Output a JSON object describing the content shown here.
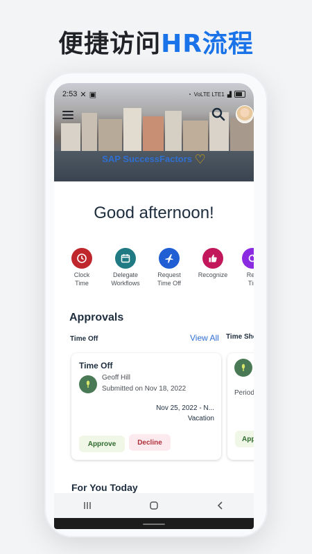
{
  "promo": {
    "title_cn": "便捷访问",
    "title_accent": "HR流程"
  },
  "status": {
    "time": "2:53",
    "network": "VoLTE LTE1"
  },
  "header": {
    "brand": "SAP SuccessFactors"
  },
  "greeting": "Good afternoon!",
  "quick_actions": [
    {
      "label1": "Clock",
      "label2": "Time",
      "color": "#c0272d"
    },
    {
      "label1": "Delegate",
      "label2": "Workflows",
      "color": "#1f7a83"
    },
    {
      "label1": "Request",
      "label2": "Time Off",
      "color": "#1f5fd3"
    },
    {
      "label1": "Recognize",
      "label2": "",
      "color": "#c2185b"
    },
    {
      "label1": "Req",
      "label2": "Tin",
      "color": "#8a2be2"
    }
  ],
  "approvals": {
    "title": "Approvals",
    "tab_time_off": "Time Off",
    "view_all": "View All",
    "tab_time_sheet": "Time She",
    "card1": {
      "title": "Time Off",
      "name": "Geoff Hill",
      "submitted": "Submitted on Nov 18, 2022",
      "dates": "Nov 25, 2022 - N...",
      "type": "Vacation",
      "approve": "Approve",
      "decline": "Decline"
    },
    "card2": {
      "period": "Period",
      "approve": "Appr"
    }
  },
  "for_you": "For You Today"
}
